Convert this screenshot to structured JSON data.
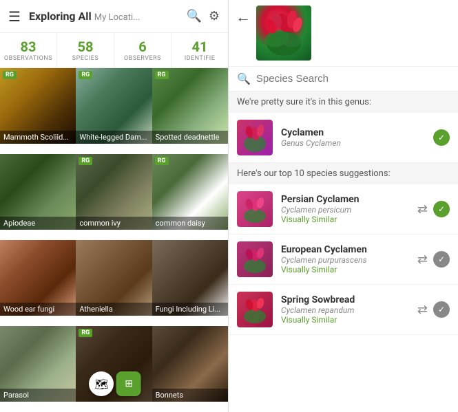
{
  "left": {
    "title": "Exploring All",
    "location": "My Locati...",
    "stats": [
      {
        "number": "83",
        "label": "OBSERVATIONS"
      },
      {
        "number": "58",
        "label": "SPECIES"
      },
      {
        "number": "6",
        "label": "OBSERVERS"
      },
      {
        "number": "41",
        "label": "IDENTIFIE"
      }
    ],
    "grid_items": [
      {
        "label": "Mammoth Scoliid...",
        "rg": true,
        "class": "cell-1"
      },
      {
        "label": "White-legged Dam...",
        "rg": true,
        "class": "cell-2"
      },
      {
        "label": "Spotted deadnettle",
        "rg": true,
        "class": "cell-3"
      },
      {
        "label": "Apiodeae",
        "rg": false,
        "class": "cell-4"
      },
      {
        "label": "common ivy",
        "rg": true,
        "class": "cell-5"
      },
      {
        "label": "common daisy",
        "rg": true,
        "class": "cell-6"
      },
      {
        "label": "Wood ear fungi",
        "rg": false,
        "class": "cell-7"
      },
      {
        "label": "Atheniella",
        "rg": false,
        "class": "cell-8"
      },
      {
        "label": "Fungi Including Li...",
        "rg": false,
        "class": "cell-9"
      },
      {
        "label": "Parasol",
        "rg": false,
        "class": "cell-10"
      },
      {
        "label": "",
        "rg": true,
        "class": "cell-11",
        "is_map": true
      },
      {
        "label": "Bonnets",
        "rg": false,
        "class": "cell-12"
      }
    ],
    "rg_label": "RG"
  },
  "right": {
    "search_placeholder": "Species Search",
    "genus_header": "We're pretty sure it's in this genus:",
    "suggestions_header": "Here's our top 10 species suggestions:",
    "genus": {
      "name": "Cyclamen",
      "sci": "Genus Cyclamen"
    },
    "suggestions": [
      {
        "name": "Persian Cyclamen",
        "sci": "Cyclamen persicum",
        "similar": "Visually Similar",
        "active": true
      },
      {
        "name": "European Cyclamen",
        "sci": "Cyclamen purpurascens",
        "similar": "Visually Similar",
        "active": false
      },
      {
        "name": "Spring Sowbread",
        "sci": "Cyclamen repandum",
        "similar": "Visually Similar",
        "active": false
      }
    ]
  }
}
